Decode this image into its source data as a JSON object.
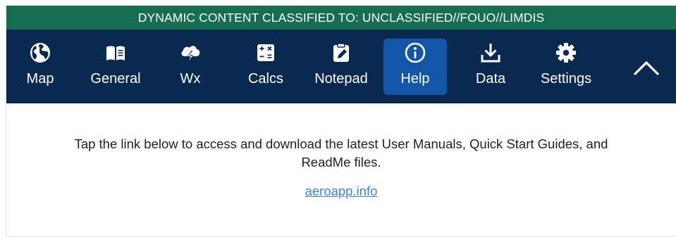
{
  "banner": {
    "text": "DYNAMIC CONTENT CLASSIFIED TO: UNCLASSIFIED//FOUO//LIMDIS"
  },
  "nav": {
    "items": [
      {
        "label": "Map",
        "icon": "globe-icon",
        "active": false
      },
      {
        "label": "General",
        "icon": "book-icon",
        "active": false
      },
      {
        "label": "Wx",
        "icon": "weather-icon",
        "active": false
      },
      {
        "label": "Calcs",
        "icon": "calculator-icon",
        "active": false
      },
      {
        "label": "Notepad",
        "icon": "notepad-icon",
        "active": false
      },
      {
        "label": "Help",
        "icon": "info-icon",
        "active": true
      },
      {
        "label": "Data",
        "icon": "download-icon",
        "active": false
      },
      {
        "label": "Settings",
        "icon": "gear-icon",
        "active": false
      }
    ],
    "collapse_icon": "chevron-up-icon"
  },
  "content": {
    "message": "Tap the link below to access and download the latest User Manuals, Quick Start Guides, and ReadMe files.",
    "link_text": "aeroapp.info"
  },
  "colors": {
    "banner_bg": "#146e4f",
    "toolbar_bg": "#0a2950",
    "active_tab_bg": "#1355a6",
    "link": "#3d82e0"
  }
}
